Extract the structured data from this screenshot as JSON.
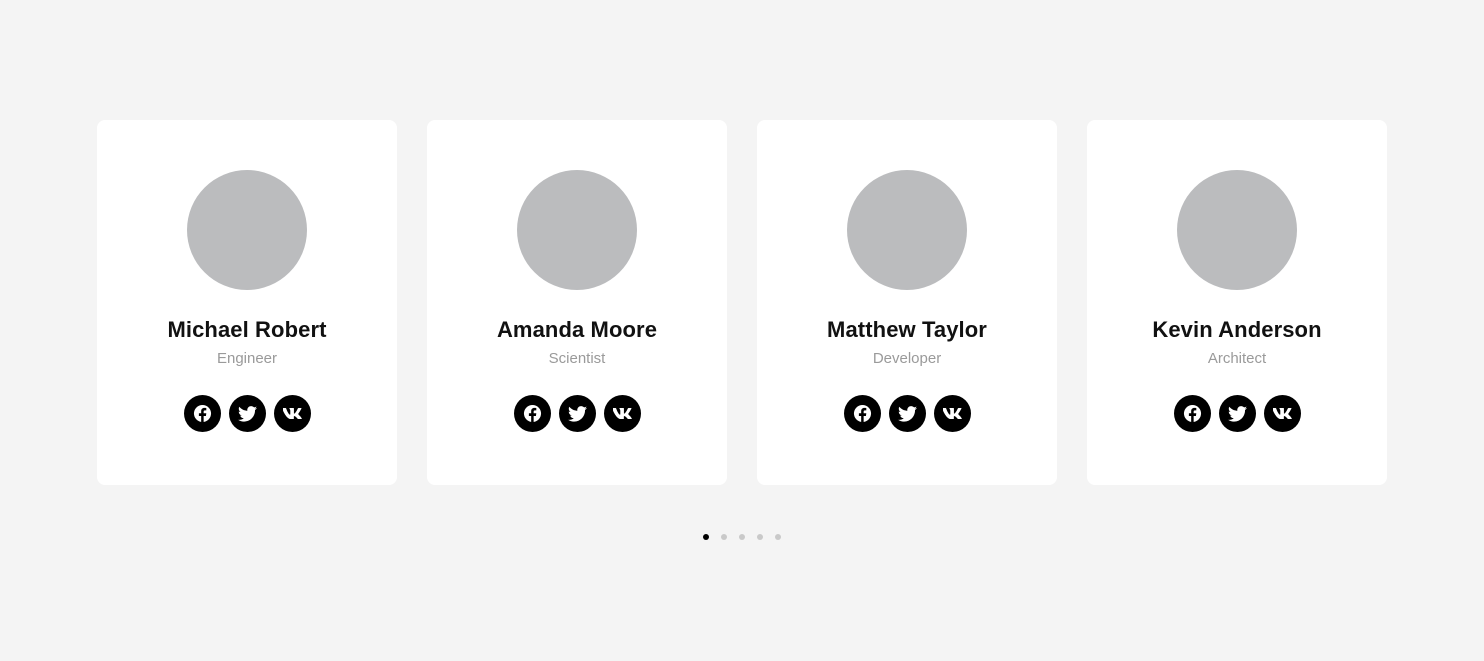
{
  "team": [
    {
      "name": "Michael Robert",
      "role": "Engineer"
    },
    {
      "name": "Amanda Moore",
      "role": "Scientist"
    },
    {
      "name": "Matthew Taylor",
      "role": "Developer"
    },
    {
      "name": "Kevin Anderson",
      "role": "Architect"
    }
  ],
  "socials": [
    "facebook-icon",
    "twitter-icon",
    "vk-icon"
  ],
  "pagination": {
    "count": 5,
    "active_index": 0
  },
  "colors": {
    "background": "#f4f4f4",
    "card": "#ffffff",
    "avatar_placeholder": "#bbbcbe",
    "name_text": "#111111",
    "role_text": "#9a9a9a",
    "social_button": "#000000",
    "dot_active": "#000000",
    "dot_inactive": "#c9c9c9"
  }
}
